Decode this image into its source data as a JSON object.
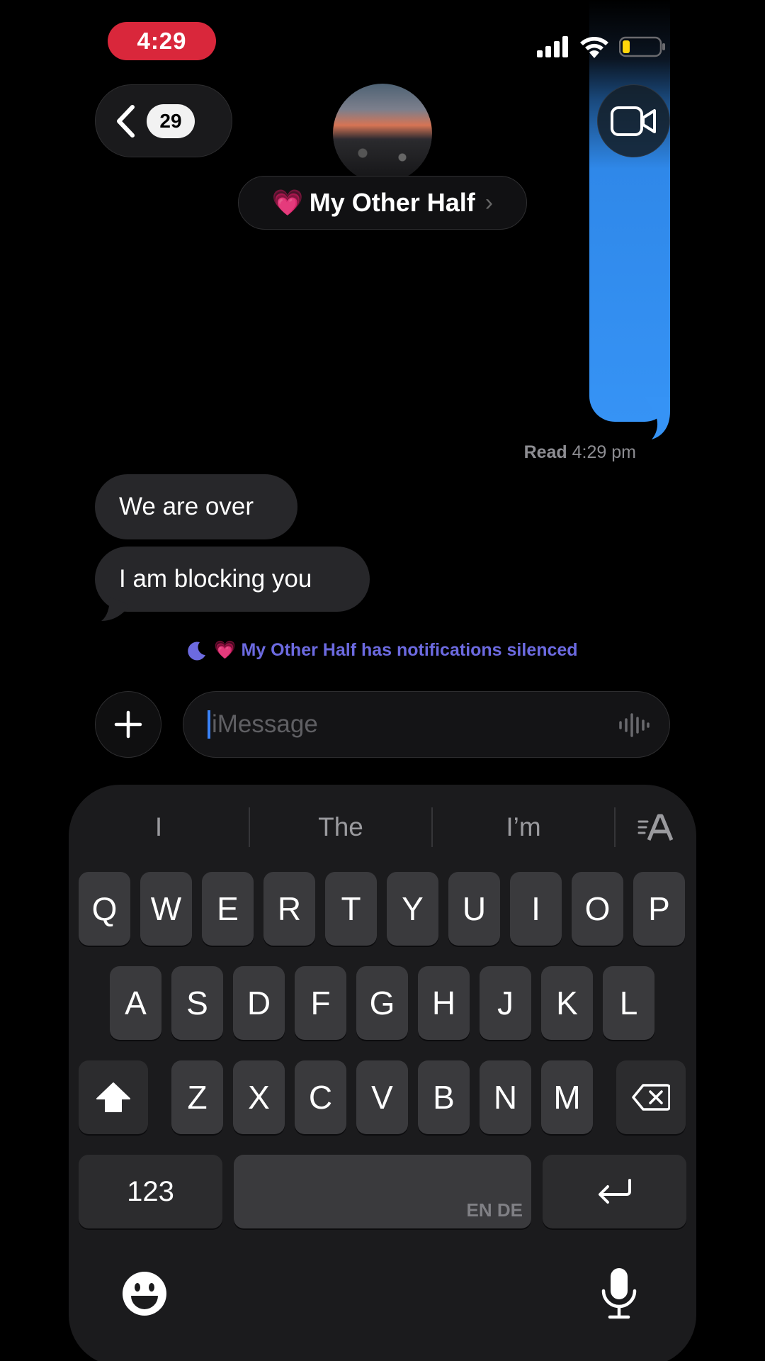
{
  "status_bar": {
    "time": "4:29"
  },
  "header": {
    "back_count": "29",
    "contact_emoji": "💗",
    "contact_name": "My Other Half",
    "chevron": "›"
  },
  "conversation": {
    "read_label": "Read",
    "read_time": "4:29 pm",
    "messages": [
      {
        "from": "them",
        "text": "We are over"
      },
      {
        "from": "them",
        "text": "I am blocking you"
      }
    ],
    "silenced_notice": "💗 My Other Half has notifications silenced"
  },
  "composer": {
    "placeholder": "iMessage",
    "value": ""
  },
  "keyboard": {
    "suggestions": [
      "I",
      "The",
      "I’m"
    ],
    "row1": [
      "Q",
      "W",
      "E",
      "R",
      "T",
      "Y",
      "U",
      "I",
      "O",
      "P"
    ],
    "row2": [
      "A",
      "S",
      "D",
      "F",
      "G",
      "H",
      "J",
      "K",
      "L"
    ],
    "row3": [
      "Z",
      "X",
      "C",
      "V",
      "B",
      "N",
      "M"
    ],
    "numbers_label": "123",
    "space_languages": "EN DE"
  },
  "colors": {
    "sent_bubble": "#3693f5",
    "received_bubble": "#27272a",
    "time_pill": "#d9273b",
    "silenced_text": "#6c6ae0"
  },
  "icons": [
    "cellular-signal-icon",
    "wifi-icon",
    "battery-icon",
    "back-chevron-icon",
    "video-camera-icon",
    "moon-icon",
    "plus-icon",
    "waveform-icon",
    "text-format-icon",
    "shift-icon",
    "backspace-icon",
    "return-icon",
    "emoji-icon",
    "microphone-icon"
  ]
}
